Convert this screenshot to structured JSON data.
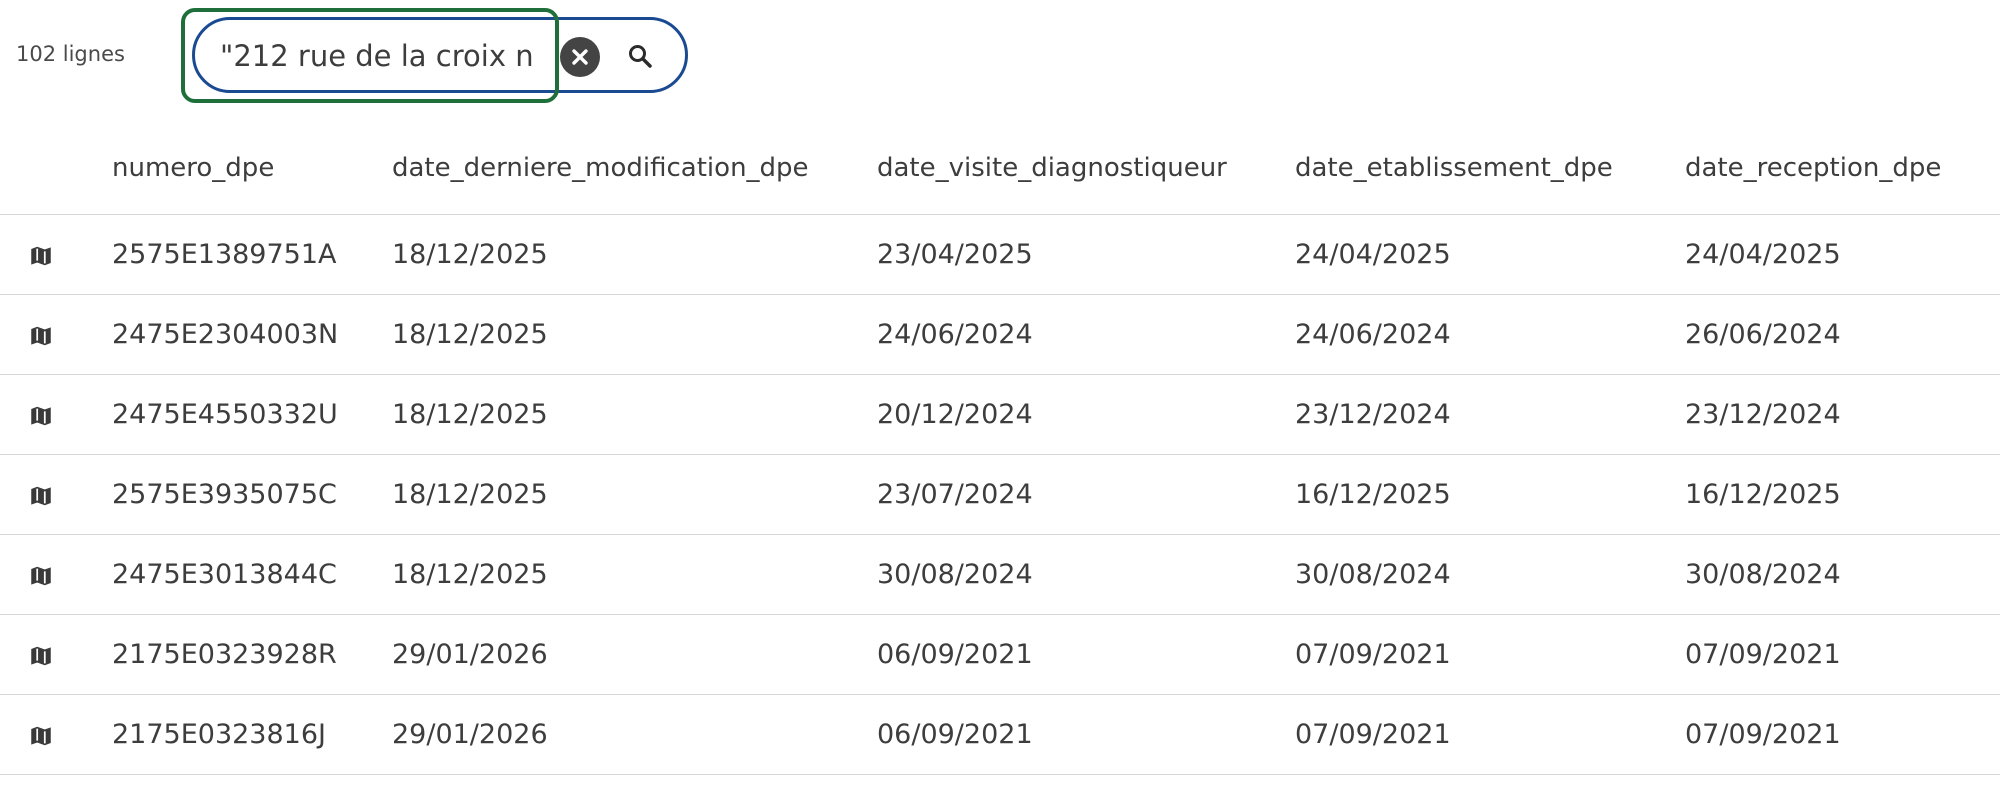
{
  "toolbar": {
    "row_count": "102 lignes",
    "search": {
      "value": "\"212 rue de la croix n",
      "clear_icon": "close-circle-icon",
      "search_icon": "magnify-icon"
    }
  },
  "table": {
    "row_icon": "map-icon",
    "columns": [
      "numero_dpe",
      "date_derniere_modification_dpe",
      "date_visite_diagnostiqueur",
      "date_etablissement_dpe",
      "date_reception_dpe"
    ],
    "rows": [
      [
        "2575E1389751A",
        "18/12/2025",
        "23/04/2025",
        "24/04/2025",
        "24/04/2025"
      ],
      [
        "2475E2304003N",
        "18/12/2025",
        "24/06/2024",
        "24/06/2024",
        "26/06/2024"
      ],
      [
        "2475E4550332U",
        "18/12/2025",
        "20/12/2024",
        "23/12/2024",
        "23/12/2024"
      ],
      [
        "2575E3935075C",
        "18/12/2025",
        "23/07/2024",
        "16/12/2025",
        "16/12/2025"
      ],
      [
        "2475E3013844C",
        "18/12/2025",
        "30/08/2024",
        "30/08/2024",
        "30/08/2024"
      ],
      [
        "2175E0323928R",
        "29/01/2026",
        "06/09/2021",
        "07/09/2021",
        "07/09/2021"
      ],
      [
        "2175E0323816J",
        "29/01/2026",
        "06/09/2021",
        "07/09/2021",
        "07/09/2021"
      ]
    ]
  },
  "colors": {
    "pill_border": "#1a4a91",
    "focus_ring": "#1f6f3a",
    "text": "#3d3d3d",
    "divider": "#d6d6d6"
  }
}
